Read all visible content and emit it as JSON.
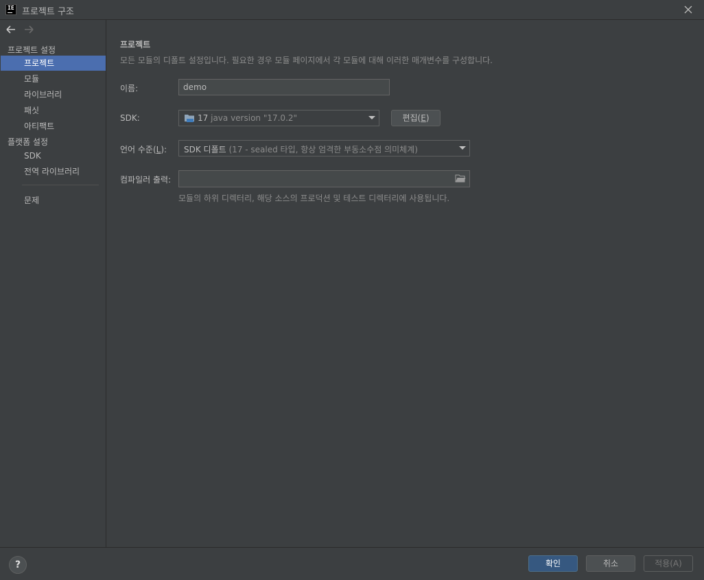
{
  "window": {
    "title": "프로젝트 구조",
    "app_icon_text": "IE"
  },
  "sidebar": {
    "section_project": "프로젝트 설정",
    "project_items": [
      {
        "label": "프로젝트",
        "selected": true
      },
      {
        "label": "모듈"
      },
      {
        "label": "라이브러리"
      },
      {
        "label": "패싯"
      },
      {
        "label": "아티팩트"
      }
    ],
    "section_platform": "플랫폼 설정",
    "platform_items": [
      {
        "label": "SDK"
      },
      {
        "label": "전역 라이브러리"
      }
    ],
    "problems": "문제"
  },
  "main": {
    "title": "프로젝트",
    "description": "모든 모듈의 디폴트 설정입니다. 필요한 경우 모듈 페이지에서 각 모듈에 대해 이러한 매개변수를 구성합니다.",
    "name_label": "이름:",
    "name_value": "demo",
    "sdk_label": "SDK:",
    "sdk_version": "17",
    "sdk_detail": "java version \"17.0.2\"",
    "edit_button_prefix": "편집(",
    "edit_button_mnemonic": "E",
    "edit_button_suffix": ")",
    "lang_label_prefix": "언어 수준(",
    "lang_label_mnemonic": "L",
    "lang_label_suffix": "):",
    "lang_value": "SDK 디폴트",
    "lang_detail": "(17 - sealed 타입, 항상 엄격한 부동소수점 의미체계)",
    "output_label": "컴파일러 출력:",
    "output_value": "",
    "output_hint": "모듈의 하위 디렉터리, 해당 소스의 프로덕션 및 테스트 디렉터리에 사용됩니다."
  },
  "footer": {
    "help": "?",
    "ok": "확인",
    "cancel": "취소",
    "apply": "적용(A)"
  },
  "colors": {
    "background": "#3c3f41",
    "selection": "#4b6eaf",
    "default_button": "#365880"
  }
}
